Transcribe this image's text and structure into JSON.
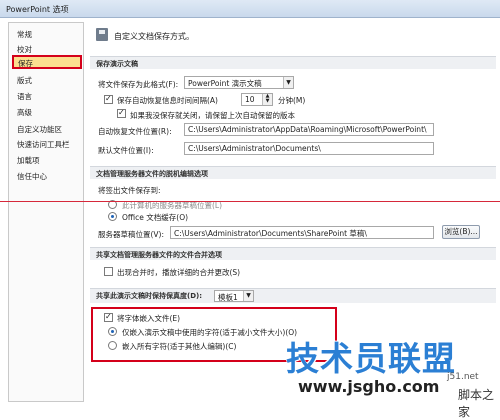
{
  "window": {
    "title": "PowerPoint 选项"
  },
  "sidebar": {
    "items": [
      {
        "label": "常规"
      },
      {
        "label": "校对"
      },
      {
        "label": "保存"
      },
      {
        "label": "版式"
      },
      {
        "label": "语言"
      },
      {
        "label": "高级"
      },
      {
        "label": "自定义功能区"
      },
      {
        "label": "快速访问工具栏"
      },
      {
        "label": "加载项"
      },
      {
        "label": "信任中心"
      }
    ],
    "selected": "保存"
  },
  "header": {
    "text": "自定义文档保存方式。"
  },
  "save_presentations": {
    "section_title": "保存演示文稿",
    "format_label": "将文件保存为此格式(F):",
    "format_value": "PowerPoint 演示文稿",
    "autorecover_label": "保存自动恢复信息时间间隔(A)",
    "autorecover_minutes": "10",
    "minutes_unit": "分钟(M)",
    "keep_last_label": "如果我没保存就关闭，请保留上次自动保留的版本",
    "autorecover_location_label": "自动恢复文件位置(R):",
    "autorecover_location_value": "C:\\Users\\Administrator\\AppData\\Roaming\\Microsoft\\PowerPoint\\",
    "default_location_label": "默认文件位置(I):",
    "default_location_value": "C:\\Users\\Administrator\\Documents\\"
  },
  "offline_editing": {
    "section_title": "文档管理服务器文件的脱机编辑选项",
    "checkout_label": "将签出文件保存到:",
    "option_server_drafts": "此计算机的服务器草稿位置(L)",
    "option_office_cache": "Office 文档缓存(O)",
    "drafts_location_label": "服务器草稿位置(V):",
    "drafts_location_value": "C:\\Users\\Administrator\\Documents\\SharePoint 草稿\\",
    "browse_button": "浏览(B)..."
  },
  "merge": {
    "section_title": "共享文档管理服务器文件的文件合并选项",
    "show_details_label": "出现合并时，播放详细的合并更改(S)"
  },
  "fidelity": {
    "section_title": "共享此演示文稿时保持保真度(D):",
    "document_value": "模板1",
    "embed_fonts_label": "将字体嵌入文件(E)",
    "option_used_chars": "仅嵌入演示文稿中使用的字符(适于减小文件大小)(O)",
    "option_all_chars": "嵌入所有字符(适于其他人编辑)(C)"
  },
  "watermark": {
    "brand": "技术员联盟",
    "url": "www.jsgho.com",
    "side_text": "j51.net",
    "side_text2": "脚本之家"
  },
  "colors": {
    "highlight_red": "#d4001a",
    "selected_bg": "#fbdf8f",
    "section_bg": "#eef0f3",
    "watermark_blue": "#2b7fd4"
  }
}
